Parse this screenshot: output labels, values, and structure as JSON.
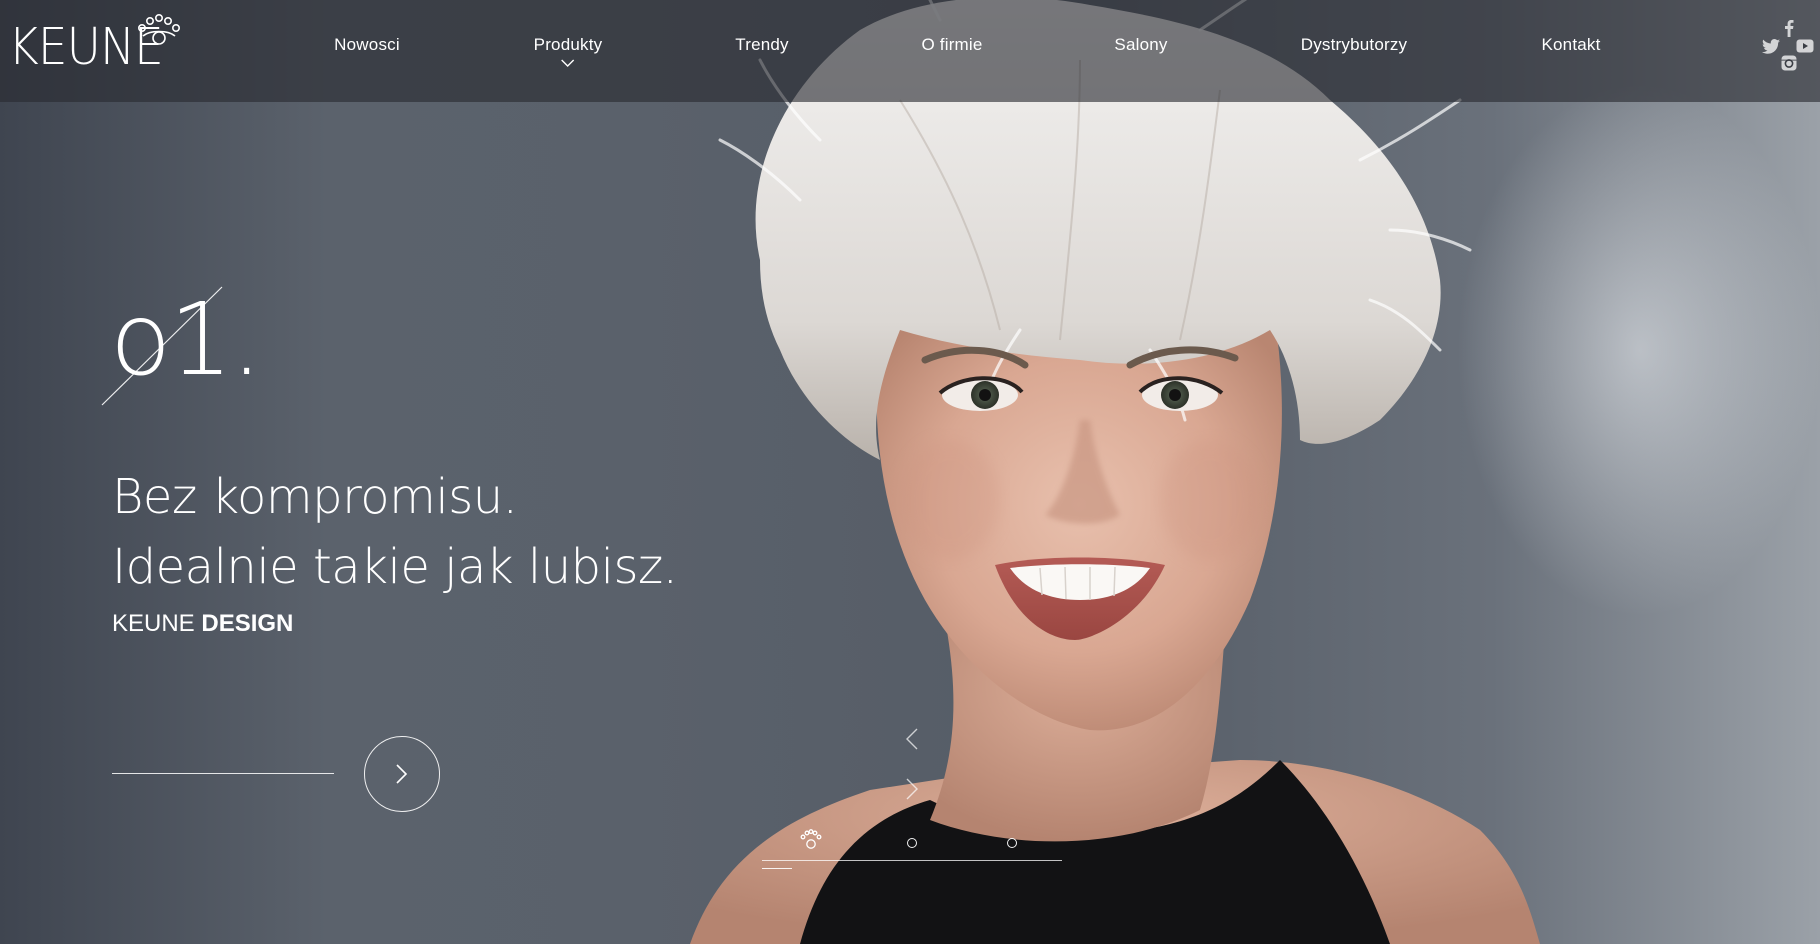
{
  "brand": {
    "logo_text": "KEUNE"
  },
  "nav": {
    "items": [
      {
        "label": "Nowosci"
      },
      {
        "label": "Produkty"
      },
      {
        "label": "Trendy"
      },
      {
        "label": "O firmie"
      },
      {
        "label": "Salony"
      },
      {
        "label": "Dystrybutorzy"
      },
      {
        "label": "Kontakt"
      }
    ],
    "dropdown_item": "Produkty"
  },
  "social": [
    "facebook-icon",
    "twitter-icon",
    "youtube-icon",
    "instagram-icon"
  ],
  "slide": {
    "number": "o1.",
    "headline_line1": "Bez kompromisu.",
    "headline_line2": "Idealnie takie jak lubisz.",
    "brand_regular": "KEUNE ",
    "brand_bold": "DESIGN"
  },
  "slider": {
    "total": 3,
    "active_index": 0
  },
  "colors": {
    "nav_bg": "#282a30",
    "text": "#ffffff"
  }
}
